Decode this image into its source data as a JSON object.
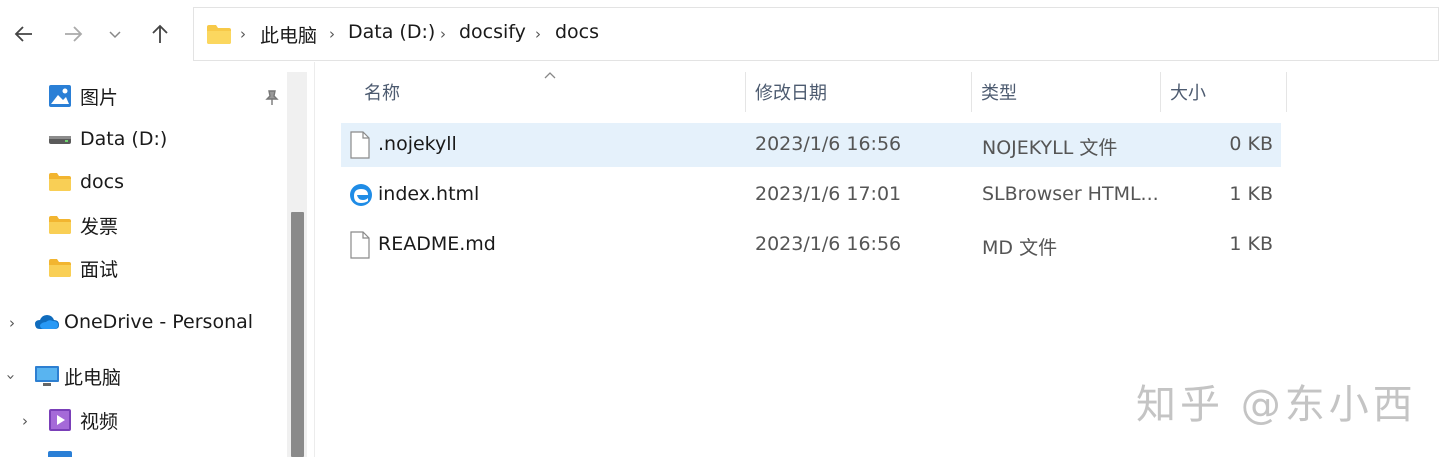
{
  "toolbar": {
    "back_icon": "back-arrow-icon",
    "forward_icon": "forward-arrow-icon",
    "history_icon": "chevron-down-icon",
    "up_icon": "up-arrow-icon"
  },
  "breadcrumb": [
    "此电脑",
    "Data (D:)",
    "docsify",
    "docs"
  ],
  "sidebar": {
    "items": [
      {
        "label": "图片",
        "icon": "pictures-icon",
        "pinned": true
      },
      {
        "label": "Data (D:)",
        "icon": "drive-icon"
      },
      {
        "label": "docs",
        "icon": "folder-icon"
      },
      {
        "label": "发票",
        "icon": "folder-icon"
      },
      {
        "label": "面试",
        "icon": "folder-icon"
      },
      {
        "label": "OneDrive - Personal",
        "icon": "onedrive-icon",
        "expander": "collapsed"
      },
      {
        "label": "此电脑",
        "icon": "pc-icon",
        "expander": "expanded"
      },
      {
        "label": "视频",
        "icon": "videos-icon",
        "expander": "collapsed"
      }
    ]
  },
  "columns": {
    "name": "名称",
    "modified": "修改日期",
    "type": "类型",
    "size": "大小"
  },
  "files": [
    {
      "name": ".nojekyll",
      "modified": "2023/1/6 16:56",
      "type": "NOJEKYLL 文件",
      "size": "0 KB",
      "icon": "file-icon",
      "selected": true
    },
    {
      "name": "index.html",
      "modified": "2023/1/6 17:01",
      "type": "SLBrowser HTML...",
      "size": "1 KB",
      "icon": "browser-icon",
      "selected": false
    },
    {
      "name": "README.md",
      "modified": "2023/1/6 16:56",
      "type": "MD 文件",
      "size": "1 KB",
      "icon": "file-icon",
      "selected": false
    }
  ],
  "watermark": "知乎 @东小西",
  "colors": {
    "selection": "#e5f1fb",
    "folder": "#f7c948",
    "accent": "#0078d4"
  }
}
